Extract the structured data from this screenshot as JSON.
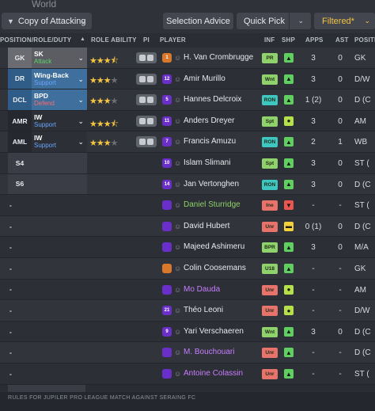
{
  "world_label": "World",
  "toolbar": {
    "tactic_label": "Copy of Attacking",
    "selection_advice": "Selection Advice",
    "quick_pick": "Quick Pick",
    "filtered": "Filtered*"
  },
  "columns": {
    "position": "POSITION/ROLE/DUTY",
    "role_ability": "ROLE ABILITY",
    "pi": "PI",
    "player": "PLAYER",
    "inf": "INF",
    "shp": "SHP",
    "apps": "APPS",
    "ast": "AST",
    "posi": "POSITI"
  },
  "rows": [
    {
      "pos": "GK",
      "role": "SK",
      "duty": "Attack",
      "duty_color": "#5fd36b",
      "stars": 3.5,
      "has_pi": true,
      "shirt": "1",
      "shirt_color": "#d9782a",
      "name": "H. Van Crombrugge",
      "name_color": "#e6e8ec",
      "inf": "PR",
      "inf_color": "#8fd16a",
      "shp": "▲",
      "shp_color": "#5fcf5f",
      "apps": "3",
      "ast": "0",
      "posi": "GK"
    },
    {
      "pos": "DR",
      "role": "Wing-Back",
      "duty": "Support",
      "duty_color": "#6aa6ff",
      "stars": 3,
      "has_pi": true,
      "shirt": "12",
      "shirt_color": "#6a2fc9",
      "name": "Amir Murillo",
      "name_color": "#e6e8ec",
      "inf": "Wnt",
      "inf_color": "#8fd16a",
      "shp": "▲",
      "shp_color": "#5fcf5f",
      "apps": "3",
      "ast": "0",
      "posi": "D/W"
    },
    {
      "pos": "DCL",
      "role": "BPD",
      "duty": "Defend",
      "duty_color": "#ff6b6b",
      "stars": 3,
      "has_pi": true,
      "shirt": "5",
      "shirt_color": "#6a2fc9",
      "name": "Hannes Delcroix",
      "name_color": "#e6e8ec",
      "inf": "RON",
      "inf_color": "#3ec6c0",
      "shp": "▲",
      "shp_color": "#5fcf5f",
      "apps": "1 (2)",
      "ast": "0",
      "posi": "D (C"
    },
    {
      "pos": "AMR",
      "role": "IW",
      "duty": "Support",
      "duty_color": "#6aa6ff",
      "stars": 3.5,
      "has_pi": true,
      "shirt": "11",
      "shirt_color": "#6a2fc9",
      "name": "Anders Dreyer",
      "name_color": "#e6e8ec",
      "inf": "Spt",
      "inf_color": "#8fd16a",
      "shp": "●",
      "shp_color": "#b5e04a",
      "apps": "3",
      "ast": "0",
      "posi": "AM"
    },
    {
      "pos": "AML",
      "role": "IW",
      "duty": "Support",
      "duty_color": "#6aa6ff",
      "stars": 3,
      "has_pi": true,
      "shirt": "7",
      "shirt_color": "#6a2fc9",
      "name": "Francis Amuzu",
      "name_color": "#e6e8ec",
      "inf": "RON",
      "inf_color": "#3ec6c0",
      "shp": "▲",
      "shp_color": "#5fcf5f",
      "apps": "2",
      "ast": "1",
      "posi": "WB"
    },
    {
      "pos": "S4",
      "role": "",
      "duty": "",
      "duty_color": "#ffffff",
      "stars": 0,
      "has_pi": false,
      "shirt": "10",
      "shirt_color": "#6a2fc9",
      "name": "Islam Slimani",
      "name_color": "#e6e8ec",
      "inf": "Spt",
      "inf_color": "#8fd16a",
      "shp": "▲",
      "shp_color": "#5fcf5f",
      "apps": "3",
      "ast": "0",
      "posi": "ST ("
    },
    {
      "pos": "S6",
      "role": "",
      "duty": "",
      "duty_color": "#ffffff",
      "stars": 0,
      "has_pi": false,
      "shirt": "14",
      "shirt_color": "#6a2fc9",
      "name": "Jan Vertonghen",
      "name_color": "#e6e8ec",
      "inf": "RON",
      "inf_color": "#3ec6c0",
      "shp": "▲",
      "shp_color": "#5fcf5f",
      "apps": "3",
      "ast": "0",
      "posi": "D (C"
    },
    {
      "pos": "-",
      "role": "",
      "duty": "",
      "duty_color": "#ffffff",
      "stars": 0,
      "has_pi": false,
      "shirt": "",
      "shirt_color": "#6a2fc9",
      "name": "Daniel Sturridge",
      "name_color": "#8fd16a",
      "inf": "Ine",
      "inf_color": "#e8736b",
      "shp": "▼",
      "shp_color": "#e8564f",
      "apps": "-",
      "ast": "-",
      "posi": "ST ("
    },
    {
      "pos": "-",
      "role": "",
      "duty": "",
      "duty_color": "#ffffff",
      "stars": 0,
      "has_pi": false,
      "shirt": "",
      "shirt_color": "#6a2fc9",
      "name": "David Hubert",
      "name_color": "#e6e8ec",
      "inf": "Unr",
      "inf_color": "#e8736b",
      "shp": "▬",
      "shp_color": "#f2d13a",
      "apps": "0 (1)",
      "ast": "0",
      "posi": "D (C"
    },
    {
      "pos": "-",
      "role": "",
      "duty": "",
      "duty_color": "#ffffff",
      "stars": 0,
      "has_pi": false,
      "shirt": "",
      "shirt_color": "#6a2fc9",
      "name": "Majeed Ashimeru",
      "name_color": "#e6e8ec",
      "inf": "BPR",
      "inf_color": "#8fd16a",
      "shp": "▲",
      "shp_color": "#5fcf5f",
      "apps": "3",
      "ast": "0",
      "posi": "M/A"
    },
    {
      "pos": "-",
      "role": "",
      "duty": "",
      "duty_color": "#ffffff",
      "stars": 0,
      "has_pi": false,
      "shirt": "",
      "shirt_color": "#d9782a",
      "name": "Colin Coosemans",
      "name_color": "#e6e8ec",
      "inf": "U18",
      "inf_color": "#8fd16a",
      "shp": "▲",
      "shp_color": "#5fcf5f",
      "apps": "-",
      "ast": "-",
      "posi": "GK"
    },
    {
      "pos": "-",
      "role": "",
      "duty": "",
      "duty_color": "#ffffff",
      "stars": 0,
      "has_pi": false,
      "shirt": "",
      "shirt_color": "#6a2fc9",
      "name": "Mo Dauda",
      "name_color": "#c77dff",
      "inf": "Unr",
      "inf_color": "#e8736b",
      "shp": "●",
      "shp_color": "#b5e04a",
      "apps": "-",
      "ast": "-",
      "posi": "AM"
    },
    {
      "pos": "-",
      "role": "",
      "duty": "",
      "duty_color": "#ffffff",
      "stars": 0,
      "has_pi": false,
      "shirt": "21",
      "shirt_color": "#6a2fc9",
      "name": "Théo Leoni",
      "name_color": "#e6e8ec",
      "inf": "Unr",
      "inf_color": "#e8736b",
      "shp": "●",
      "shp_color": "#b5e04a",
      "apps": "-",
      "ast": "-",
      "posi": "D/W"
    },
    {
      "pos": "-",
      "role": "",
      "duty": "",
      "duty_color": "#ffffff",
      "stars": 0,
      "has_pi": false,
      "shirt": "9",
      "shirt_color": "#6a2fc9",
      "name": "Yari Verschaeren",
      "name_color": "#e6e8ec",
      "inf": "Wnt",
      "inf_color": "#8fd16a",
      "shp": "▲",
      "shp_color": "#5fcf5f",
      "apps": "3",
      "ast": "0",
      "posi": "D (C"
    },
    {
      "pos": "-",
      "role": "",
      "duty": "",
      "duty_color": "#ffffff",
      "stars": 0,
      "has_pi": false,
      "shirt": "",
      "shirt_color": "#6a2fc9",
      "name": "M. Bouchouari",
      "name_color": "#c77dff",
      "inf": "Unr",
      "inf_color": "#e8736b",
      "shp": "▲",
      "shp_color": "#5fcf5f",
      "apps": "-",
      "ast": "-",
      "posi": "D (C"
    },
    {
      "pos": "-",
      "role": "",
      "duty": "",
      "duty_color": "#ffffff",
      "stars": 0,
      "has_pi": false,
      "shirt": "",
      "shirt_color": "#6a2fc9",
      "name": "Antoine Colassin",
      "name_color": "#c77dff",
      "inf": "Unr",
      "inf_color": "#e8736b",
      "shp": "▲",
      "shp_color": "#5fcf5f",
      "apps": "-",
      "ast": "-",
      "posi": "ST ("
    }
  ],
  "footer_text": "RULES FOR JUPILER PRO LEAGUE MATCH AGAINST SERAING FC"
}
